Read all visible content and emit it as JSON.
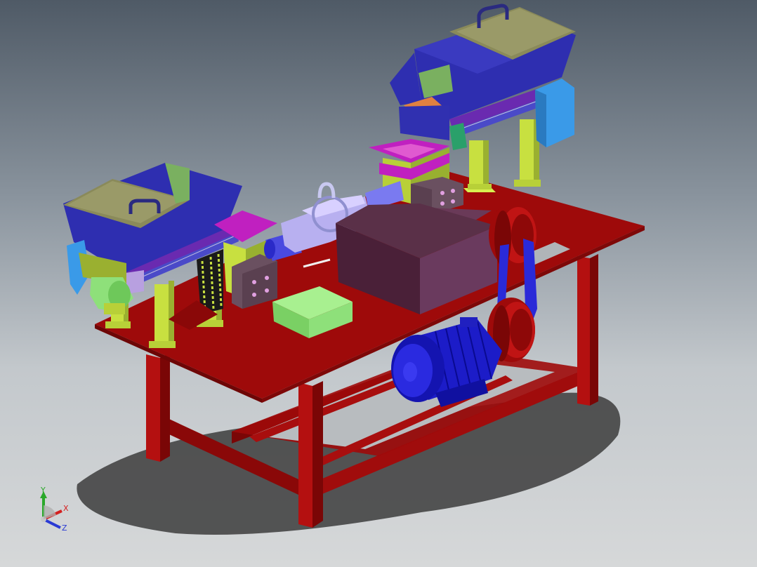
{
  "triad": {
    "y_label": "Y",
    "x_label": "X",
    "z_label": "Z",
    "colors": {
      "y": "#2aa82a",
      "x": "#d42020",
      "z": "#2a3ad4"
    }
  },
  "colors": {
    "table": "#9e0a0a",
    "table_dark": "#6e0606",
    "hopper_blue": "#2e2eb0",
    "hopper_lid": "#8a8a5a",
    "support_yellow": "#c8e040",
    "motor_blue": "#1c1cc8",
    "housing_maroon": "#5a3048",
    "block_green": "#8ee07a",
    "magenta": "#c020c0",
    "lavender": "#b8b0f0",
    "cyan_guard": "#3a9ae8"
  }
}
